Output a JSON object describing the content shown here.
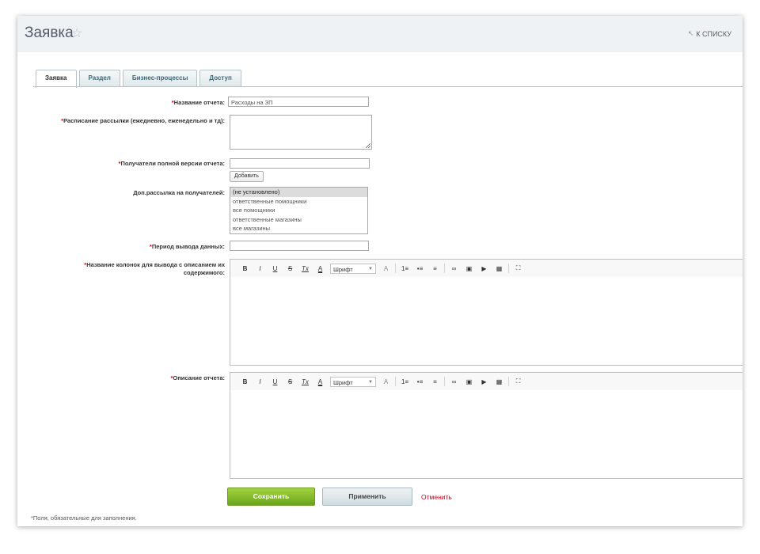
{
  "header": {
    "title": "Заявка",
    "star_icon": "☆",
    "back_link": "к списку",
    "back_icon": "↖"
  },
  "tabs": [
    {
      "label": "Заявка",
      "active": true
    },
    {
      "label": "Раздел",
      "active": false
    },
    {
      "label": "Бизнес-процессы",
      "active": false
    },
    {
      "label": "Доступ",
      "active": false
    }
  ],
  "form": {
    "required_mark": "*",
    "report_name": {
      "label": "Название отчета:",
      "value": "Расходы на ЗП"
    },
    "schedule": {
      "label": "Расписание рассылки (ежедневно, еженедельно и тд):",
      "value": ""
    },
    "recipients": {
      "label": "Получатели полной версии отчета:",
      "value": "",
      "add_button": "Добавить"
    },
    "extra_mailing": {
      "label": "Доп.рассылка на получателей:",
      "options": [
        {
          "label": "(не установлено)",
          "selected": true
        },
        {
          "label": "ответственные помощники",
          "selected": false
        },
        {
          "label": "все помощники",
          "selected": false
        },
        {
          "label": "ответственные магазины",
          "selected": false
        },
        {
          "label": "все магазины",
          "selected": false
        }
      ]
    },
    "period": {
      "label": "Период вывода данных:",
      "value": ""
    },
    "columns": {
      "label": "Название колонок для вывода с описанием их содержимого:"
    },
    "description": {
      "label": "Описание отчета:"
    }
  },
  "editor_toolbar": {
    "bold": "B",
    "italic": "I",
    "underline": "U",
    "strike": "S",
    "clear_format": "Tx",
    "font_color": "A",
    "font_select": "Шрифт",
    "font_size": "A",
    "ordered_list": "1≡",
    "bullet_list": "•≡",
    "align": "≡",
    "link": "∞",
    "image": "▣",
    "video": "▶",
    "table": "▦",
    "fullscreen": "⛶"
  },
  "actions": {
    "save": "Сохранить",
    "apply": "Применить",
    "cancel": "Отменить"
  },
  "footnote": "*Поля, обязательные для заполнения."
}
